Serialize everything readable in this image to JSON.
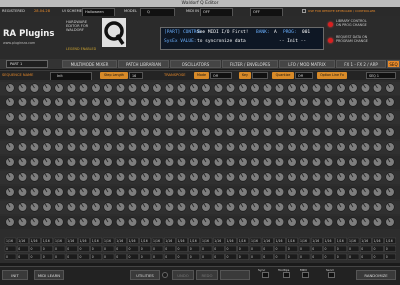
{
  "window": {
    "title": "Waldorf Q Editor"
  },
  "topbar": {
    "registered": "REGISTERED",
    "version": "28.04.28",
    "scheme_label": "UI SCHEME",
    "scheme_value": "Halloween",
    "model_label": "MODEL",
    "model_value": "Q",
    "midi_in_label": "MIDI IN",
    "midi_in_value": "OFF",
    "midi_out_value": "OFF",
    "remote_label": "USE FOR REMOTE KEYBOARD / CONTROLLER"
  },
  "header": {
    "logo": "RA Plugins",
    "logo_sub": "www.pluginsra.com",
    "hardware_editor": "HARDWARE\nEDITOR FOR\nWALDORF",
    "legacy": "LEGEND ENABLED",
    "library_label": "LIBRARY CONTROL\nON PROG CHANGE",
    "request_label": "REQUEST DATA ON\nPROGRAM CHANGE"
  },
  "lcd": {
    "part_control": "[PART] CONTROL:",
    "send_msg": "See MIDI I/O First!",
    "bank_label": "BANK:",
    "bank_value": "A",
    "prog_label": "PROG:",
    "prog_value": "001",
    "sysex_label": "SysEx VALUE:",
    "sync_msg": "to syncronize data",
    "dots": "-- Init --"
  },
  "tabs": {
    "part": "PART 1",
    "items": [
      "MULTIMODE MIXER",
      "PATCH LIBRARIAN",
      "OSCILLATORS",
      "FILTER / ENVELOPES",
      "LFO / MOD MATRIX",
      "FX 1 - FX 2 / ARP",
      "SEQ"
    ]
  },
  "seq": {
    "name_label": "SEQUENCE NAME",
    "name_value": "Init",
    "step_length": "Step Length",
    "step_length_value": "16",
    "transpose": "TRANSPOSE",
    "mode_label": "Mode",
    "mode_value": "Off",
    "key_label": "Key",
    "quantize": "Quantize",
    "quantize_value": "Off",
    "option": "Option Line Fx",
    "last_value": "SEQ 1"
  },
  "grid": {
    "tick_value": "1/16",
    "knob_values": [
      "0",
      "0",
      "0",
      "0",
      "0",
      "0",
      "0",
      "0",
      "0",
      "0",
      "0",
      "0",
      "0",
      "0",
      "0",
      "0"
    ],
    "step_numbers": [
      "1",
      "2",
      "3",
      "4",
      "5",
      "6",
      "7",
      "8",
      "9",
      "10",
      "11",
      "12",
      "13",
      "14",
      "15",
      "16"
    ]
  },
  "bottom": {
    "init": "INIT",
    "midi_learn": "MIDI LEARN",
    "utilities": "UTILITIES",
    "undo": "UNDO",
    "redo": "REDO",
    "sync_label": "Sync",
    "sync_sub": "to Edit",
    "tooltips_label": "Tooltips",
    "tooltips_sub": "OFF",
    "midi_label": "MIDI",
    "midi_sub": "thru",
    "share_label": "Send",
    "share_sub": "on change",
    "randomize": "RANDOMIZE"
  },
  "colors": {
    "accent": "#e88a2a",
    "led": "#d92020",
    "knob": "#8a8a8a",
    "background": "#1a1a1a"
  }
}
